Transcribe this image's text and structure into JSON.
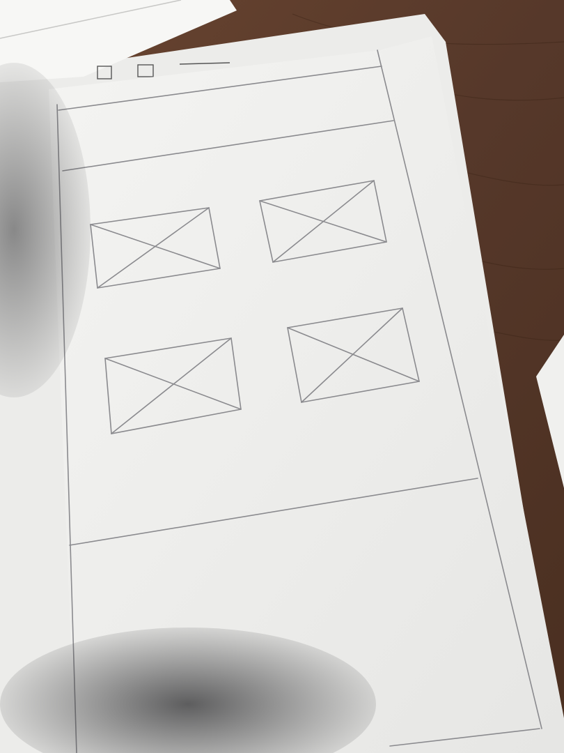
{
  "scene": {
    "description_kind": "hand-drawn pencil wireframe on paper",
    "colors": {
      "table_wood": "#5a3a26",
      "paper": "#f2f2f0",
      "paper_shade": "#e4e4e2",
      "pencil": "#8a8a8e",
      "shadow": "#3a3a3c"
    }
  },
  "wireframe": {
    "sections": [
      "header",
      "navigation-bar",
      "image-grid",
      "footer"
    ],
    "image_placeholders": [
      {
        "row": 1,
        "col": 1
      },
      {
        "row": 1,
        "col": 2
      },
      {
        "row": 2,
        "col": 1
      },
      {
        "row": 2,
        "col": 2
      }
    ]
  }
}
